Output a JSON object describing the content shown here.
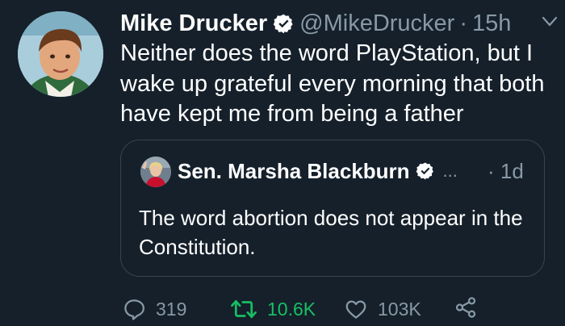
{
  "tweet": {
    "author_name": "Mike Drucker",
    "handle": "@MikeDrucker",
    "separator": "·",
    "time": "15h",
    "text": "Neither does the word PlayStation, but I wake up grateful every morning that both have kept me from being a father",
    "avatar_icon": "child-portrait-avatar",
    "verified_icon": "verified-badge-icon",
    "menu_icon": "chevron-down-icon"
  },
  "quoted_tweet": {
    "author_name": "Sen. Marsha Blackburn",
    "ellipsis": "...",
    "separator": "·",
    "time": "1d",
    "text": "The word abortion does not appear in the Constitution.",
    "avatar_icon": "senator-portrait-avatar"
  },
  "actions": {
    "reply_count": "319",
    "retweet_count": "10.6K",
    "like_count": "103K",
    "reply_icon": "reply-bubble-icon",
    "retweet_icon": "retweet-icon",
    "like_icon": "heart-icon",
    "share_icon": "share-icon"
  },
  "colors": {
    "background": "#15202b",
    "text_primary": "#ffffff",
    "text_secondary": "#8899a6",
    "verified_blue": "#1da1f2",
    "retweet_active": "#17bf63",
    "border": "#38444d"
  }
}
